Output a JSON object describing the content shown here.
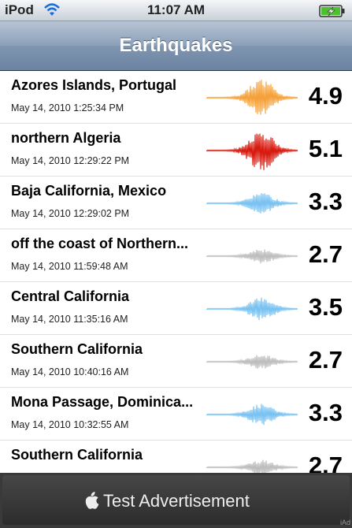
{
  "status": {
    "carrier": "iPod",
    "time": "11:07 AM"
  },
  "navbar": {
    "title": "Earthquakes"
  },
  "colors": {
    "orange": "#f5a23a",
    "red": "#d81b10",
    "blue": "#79c2f1",
    "gray": "#bdbdbd"
  },
  "quakes": [
    {
      "place": "Azores Islands, Portugal",
      "time": "May 14, 2010 1:25:34 PM",
      "magnitude": "4.9",
      "wave_color": "orange"
    },
    {
      "place": "northern Algeria",
      "time": "May 14, 2010 12:29:22 PM",
      "magnitude": "5.1",
      "wave_color": "red"
    },
    {
      "place": "Baja California, Mexico",
      "time": "May 14, 2010 12:29:02 PM",
      "magnitude": "3.3",
      "wave_color": "blue"
    },
    {
      "place": "off the coast of Northern...",
      "time": "May 14, 2010 11:59:48 AM",
      "magnitude": "2.7",
      "wave_color": "gray"
    },
    {
      "place": "Central California",
      "time": "May 14, 2010 11:35:16 AM",
      "magnitude": "3.5",
      "wave_color": "blue"
    },
    {
      "place": "Southern California",
      "time": "May 14, 2010 10:40:16 AM",
      "magnitude": "2.7",
      "wave_color": "gray"
    },
    {
      "place": "Mona Passage, Dominica...",
      "time": "May 14, 2010 10:32:55 AM",
      "magnitude": "3.3",
      "wave_color": "blue"
    },
    {
      "place": "Southern California",
      "time": "",
      "magnitude": "2.7",
      "wave_color": "gray"
    }
  ],
  "ad": {
    "label": "Test Advertisement",
    "badge": "iAd"
  }
}
